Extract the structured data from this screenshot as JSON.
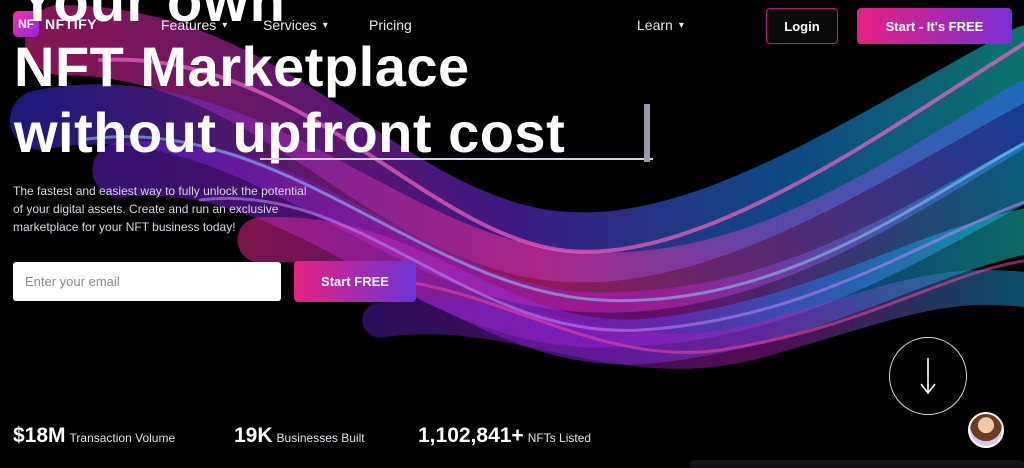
{
  "header": {
    "logo_mark": "NF",
    "logo_text": "NFTIFY",
    "nav": [
      {
        "label": "Features",
        "has_dropdown": true
      },
      {
        "label": "Services",
        "has_dropdown": true
      },
      {
        "label": "Pricing",
        "has_dropdown": false
      },
      {
        "label": "Learn",
        "has_dropdown": true
      }
    ],
    "login_label": "Login",
    "start_label": "Start - It's FREE",
    "caret": "▾"
  },
  "hero": {
    "line0": "Your own",
    "line1": "NFT Marketplace",
    "line2_a": "without ",
    "line2_b": "upfront cost",
    "subtitle": "The fastest and easiest way to fully unlock the potential of your digital assets. Create and run an exclusive marketplace for your NFT business today!",
    "email_placeholder": "Enter your email",
    "start_free_label": "Start FREE"
  },
  "stats": [
    {
      "value": "$18M",
      "label": "Transaction Volume"
    },
    {
      "value": "19K",
      "label": "Businesses Built"
    },
    {
      "value": "1,102,841+",
      "label": "NFTs Listed"
    }
  ],
  "icons": {
    "scroll": "arrow-down-icon",
    "avatar": "support-avatar-icon"
  },
  "colors": {
    "accent_pink": "#e8207f",
    "accent_purple": "#6a35d8",
    "background": "#000000"
  }
}
